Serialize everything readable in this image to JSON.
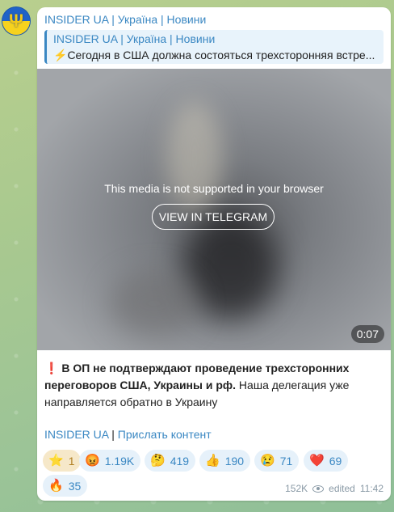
{
  "channel": {
    "name": "INSIDER UA | Україна | Новини",
    "avatar_icon": "ukraine-trident-icon"
  },
  "reply": {
    "title": "INSIDER UA | Україна | Новини",
    "icon": "⚡",
    "text": "Сегодня в США должна состояться трехсторонняя встре..."
  },
  "media": {
    "unsupported_text": "This media is not supported in your browser",
    "button_label": "VIEW IN TELEGRAM",
    "duration": "0:07"
  },
  "message": {
    "icon": "❗",
    "bold": "В ОП не подтверждают проведение трехсторонних переговоров США, Украины и рф.",
    "rest": " Наша делегация уже направляется обратно в Украину"
  },
  "links": {
    "channel": "INSIDER UA",
    "separator": " | ",
    "submit": "Прислать контент"
  },
  "reactions": [
    {
      "emoji": "⭐",
      "count": "1"
    },
    {
      "emoji": "😡",
      "count": "1.19K"
    },
    {
      "emoji": "🤔",
      "count": "419"
    },
    {
      "emoji": "👍",
      "count": "190"
    },
    {
      "emoji": "😢",
      "count": "71"
    },
    {
      "emoji": "❤️",
      "count": "69"
    },
    {
      "emoji": "🔥",
      "count": "35"
    }
  ],
  "meta": {
    "views": "152K",
    "edited": "edited",
    "time": "11:42"
  }
}
